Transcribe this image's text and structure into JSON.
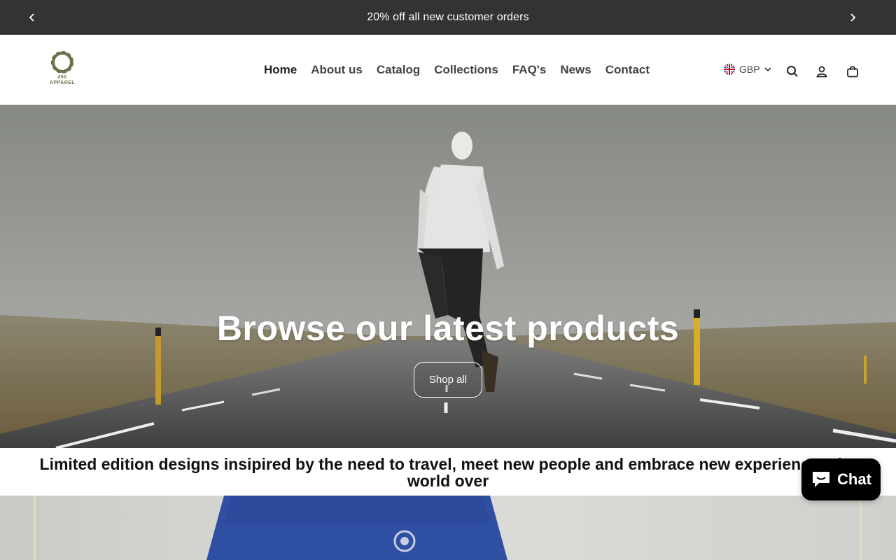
{
  "announcement": {
    "text": "20% off all new customer orders",
    "prev_icon": "chevron-left-icon",
    "next_icon": "chevron-right-icon"
  },
  "header": {
    "logo": {
      "line1": "450",
      "line2": "APPAREL"
    },
    "nav": [
      {
        "label": "Home",
        "active": true
      },
      {
        "label": "About us"
      },
      {
        "label": "Catalog"
      },
      {
        "label": "Collections"
      },
      {
        "label": "FAQ's"
      },
      {
        "label": "News"
      },
      {
        "label": "Contact"
      }
    ],
    "currency": {
      "code": "GBP",
      "flag_icon": "uk-flag-icon"
    },
    "icons": [
      "search-icon",
      "account-icon",
      "cart-icon"
    ]
  },
  "hero": {
    "title": "Browse our latest products",
    "button_label": "Shop all"
  },
  "tagline": {
    "text": "Limited edition designs insipired by the need to travel, meet new people and embrace new experiences the world over"
  },
  "chat": {
    "label": "Chat",
    "icon": "chat-bubble-icon"
  },
  "colors": {
    "announcement_bg": "#333333",
    "chat_bg": "#000000",
    "logo": "#6b7048",
    "shirt": "#2f4fa3"
  }
}
